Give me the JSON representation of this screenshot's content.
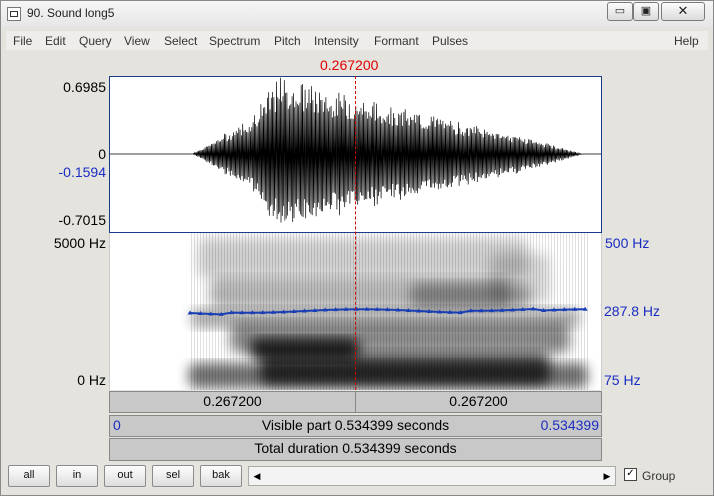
{
  "window": {
    "title": "90. Sound long5"
  },
  "titlebar_buttons": {
    "minimize": "▭",
    "maximize": "▣",
    "close": "✕"
  },
  "menu": [
    "File",
    "Edit",
    "Query",
    "View",
    "Select",
    "Spectrum",
    "Pitch",
    "Intensity",
    "Formant",
    "Pulses",
    "Help"
  ],
  "cursor": {
    "time_label": "0.267200",
    "position_fraction": 0.5
  },
  "waveform": {
    "ymax": "0.6985",
    "zero": "0",
    "cursor_value": "-0.1594",
    "ymin": "-0.7015"
  },
  "spectrogram": {
    "fmax": "5000 Hz",
    "fmin": "0 Hz"
  },
  "pitch": {
    "max": "500 Hz",
    "current": "287.8 Hz",
    "min": "75 Hz"
  },
  "bars": {
    "left_time": "0.267200",
    "right_time": "0.267200",
    "visible_start": "0",
    "visible_label": "Visible part 0.534399 seconds",
    "visible_end": "0.534399",
    "total_label": "Total duration 0.534399 seconds"
  },
  "buttons": {
    "all": "all",
    "in": "in",
    "out": "out",
    "sel": "sel",
    "bak": "bak"
  },
  "group": {
    "label": "Group",
    "checked": true,
    "check_glyph": "✓"
  },
  "colors": {
    "cursor": "#e00000",
    "axis_blue": "#1a2dc2",
    "pitch": "#1a3fb5"
  }
}
